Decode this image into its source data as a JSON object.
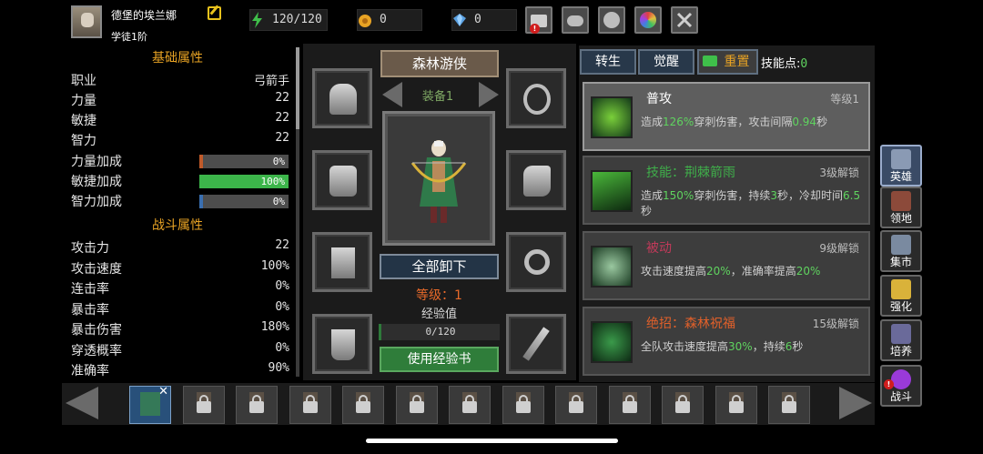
{
  "player": {
    "name": "德堡的埃兰娜",
    "rank": "学徒1阶"
  },
  "resources": {
    "energy": "120/120",
    "gold": "0",
    "gems": "0"
  },
  "left_panel": {
    "basic_title": "基础属性",
    "basic_stats": [
      {
        "label": "职业",
        "value": "弓箭手"
      },
      {
        "label": "力量",
        "value": "22"
      },
      {
        "label": "敏捷",
        "value": "22"
      },
      {
        "label": "智力",
        "value": "22"
      }
    ],
    "bonuses": [
      {
        "label": "力量加成",
        "value": "0%",
        "fraction": 0.0,
        "color": "#c05a2a"
      },
      {
        "label": "敏捷加成",
        "value": "100%",
        "fraction": 1.0,
        "color": "#3cb54a"
      },
      {
        "label": "智力加成",
        "value": "0%",
        "fraction": 0.0,
        "color": "#3a6fb0"
      }
    ],
    "combat_title": "战斗属性",
    "combat_stats": [
      {
        "label": "攻击力",
        "value": "22"
      },
      {
        "label": "攻击速度",
        "value": "100%"
      },
      {
        "label": "连击率",
        "value": "0%"
      },
      {
        "label": "暴击率",
        "value": "0%"
      },
      {
        "label": "暴击伤害",
        "value": "180%"
      },
      {
        "label": "穿透概率",
        "value": "0%"
      },
      {
        "label": "准确率",
        "value": "90%"
      }
    ]
  },
  "center": {
    "class_name": "森林游侠",
    "equip_set": "装备1",
    "unequip_all": "全部卸下",
    "level": "等级：1",
    "exp_label": "经验值",
    "exp_value": "0/120",
    "exp_fraction": 0.0,
    "use_exp_book": "使用经验书"
  },
  "tabs": {
    "rebirth": "转生",
    "awaken": "觉醒",
    "reset": "重置",
    "skill_points_label": "技能点:",
    "skill_points_value": "0"
  },
  "skills": [
    {
      "name": "普攻",
      "name_color": "#ffffff",
      "req": "等级1",
      "desc": [
        {
          "t": "造成"
        },
        {
          "t": "126%",
          "h": true
        },
        {
          "t": "穿刺伤害，攻击间隔"
        },
        {
          "t": "0.94",
          "h": true
        },
        {
          "t": "秒"
        }
      ]
    },
    {
      "name": "技能：荆棘箭雨",
      "name_color": "#3fae4a",
      "req": "3级解锁",
      "desc": [
        {
          "t": "造成"
        },
        {
          "t": "150%",
          "h": true
        },
        {
          "t": "穿刺伤害，持续"
        },
        {
          "t": "3",
          "h": true
        },
        {
          "t": "秒，冷却时间"
        },
        {
          "t": "6.5",
          "h": true
        },
        {
          "t": "秒"
        }
      ]
    },
    {
      "name": "被动",
      "name_color": "#c23a5a",
      "req": "9级解锁",
      "desc": [
        {
          "t": "攻击速度提高"
        },
        {
          "t": "20%",
          "h": true
        },
        {
          "t": "，准确率提高"
        },
        {
          "t": "20%",
          "h": true
        }
      ]
    },
    {
      "name": "绝招：森林祝福",
      "name_color": "#e0602a",
      "req": "15级解锁",
      "desc": [
        {
          "t": "全队攻击速度提高"
        },
        {
          "t": "30%",
          "h": true
        },
        {
          "t": "，持续"
        },
        {
          "t": "6",
          "h": true
        },
        {
          "t": "秒"
        }
      ]
    }
  ],
  "nav": [
    {
      "label": "英雄",
      "icon": "helmet-icon",
      "active": true,
      "color": "#8a9ab4"
    },
    {
      "label": "领地",
      "icon": "castle-icon",
      "active": false,
      "color": "#8c4a3a"
    },
    {
      "label": "集市",
      "icon": "shop-icon",
      "active": false,
      "color": "#7a8aa0"
    },
    {
      "label": "强化",
      "icon": "crystal-icon",
      "active": false,
      "color": "#d9b23a"
    },
    {
      "label": "培养",
      "icon": "flask-icon",
      "active": false,
      "color": "#6a6a9a"
    },
    {
      "label": "战斗",
      "icon": "portal-icon",
      "active": false,
      "color": "#9a3ad9"
    }
  ]
}
